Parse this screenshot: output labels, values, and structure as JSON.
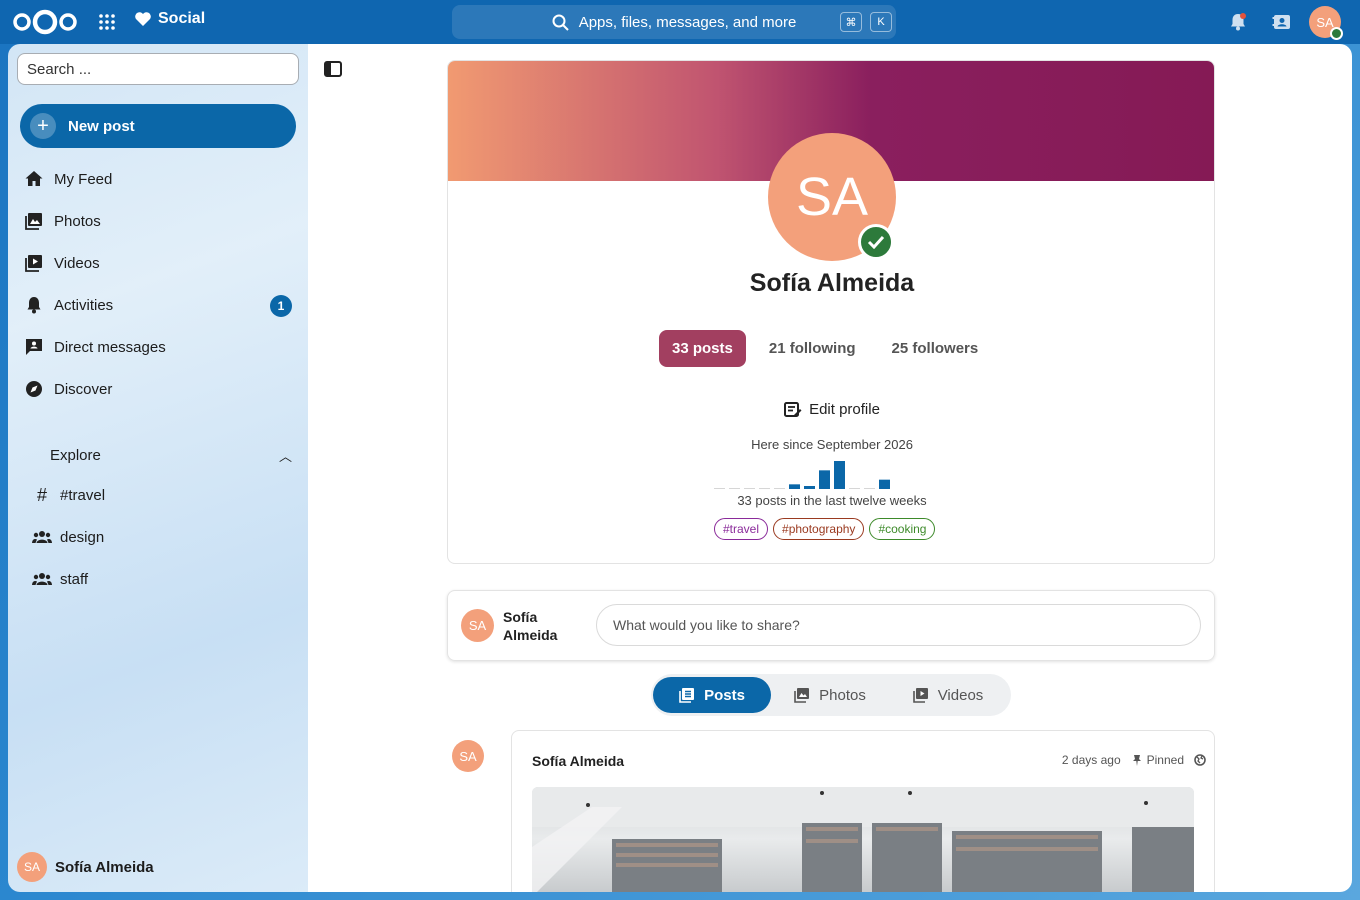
{
  "topbar": {
    "app_name": "Social",
    "search_placeholder": "Apps, files, messages, and more",
    "kbd_cmd": "⌘",
    "kbd_k": "K",
    "avatar_initials": "SA"
  },
  "sidebar": {
    "search_placeholder": "Search ...",
    "new_post_label": "New post",
    "items": [
      {
        "label": "My Feed",
        "icon": "home-icon"
      },
      {
        "label": "Photos",
        "icon": "image-icon"
      },
      {
        "label": "Videos",
        "icon": "video-icon"
      },
      {
        "label": "Activities",
        "icon": "bell-icon",
        "badge": "1"
      },
      {
        "label": "Direct messages",
        "icon": "message-icon"
      },
      {
        "label": "Discover",
        "icon": "compass-icon"
      }
    ],
    "explore_label": "Explore",
    "explore_items": [
      {
        "label": "#travel",
        "icon": "hashtag-icon"
      },
      {
        "label": "design",
        "icon": "group-icon"
      },
      {
        "label": "staff",
        "icon": "group-icon"
      }
    ],
    "user_name": "Sofía Almeida",
    "user_initials": "SA"
  },
  "profile": {
    "initials": "SA",
    "name": "Sofía Almeida",
    "stats": {
      "posts": "33 posts",
      "following": "21 following",
      "followers": "25 followers"
    },
    "edit_label": "Edit profile",
    "since": "Here since September 2026",
    "activity_caption": "33 posts in the last twelve weeks",
    "weekly_posts": [
      0,
      0,
      0,
      0,
      0,
      2,
      1,
      8,
      12,
      0,
      0,
      4
    ],
    "tags": [
      {
        "label": "#travel",
        "color": "#8a2a9a"
      },
      {
        "label": "#photography",
        "color": "#9a3a20"
      },
      {
        "label": "#cooking",
        "color": "#3d8a2a"
      }
    ]
  },
  "composer": {
    "initials": "SA",
    "name": "Sofía Almeida",
    "placeholder": "What would you like to share?"
  },
  "tabs": {
    "posts": "Posts",
    "photos": "Photos",
    "videos": "Videos"
  },
  "post": {
    "initials": "SA",
    "author": "Sofía Almeida",
    "time": "2 days ago",
    "pinned": "Pinned"
  },
  "colors": {
    "accent": "#0b67a8",
    "posts_tab": "#a23f60",
    "avatar": "#f3a07b"
  }
}
